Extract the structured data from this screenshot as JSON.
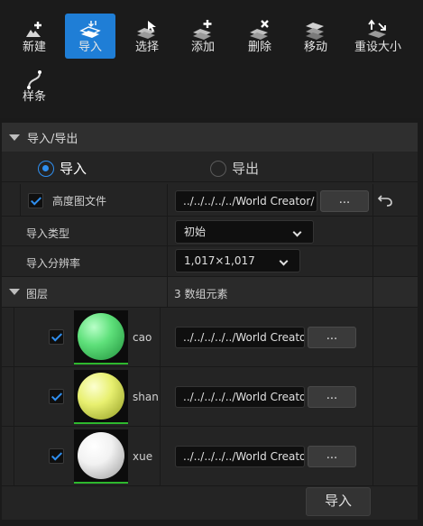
{
  "toolbar": {
    "tools": [
      {
        "label": "新建",
        "icon": "new-icon"
      },
      {
        "label": "导入",
        "icon": "import-icon",
        "active": true
      },
      {
        "label": "选择",
        "icon": "select-icon"
      },
      {
        "label": "添加",
        "icon": "add-icon"
      },
      {
        "label": "删除",
        "icon": "delete-icon"
      },
      {
        "label": "移动",
        "icon": "move-icon"
      },
      {
        "label": "重设大小",
        "icon": "resize-icon"
      },
      {
        "label": "样条",
        "icon": "spline-icon"
      }
    ]
  },
  "section": {
    "title": "导入/导出",
    "mode_import": "导入",
    "mode_export": "导出",
    "mode_selected": "import"
  },
  "heightmap": {
    "label": "高度图文件",
    "checked": true,
    "path": "../../../../../World Creator/",
    "browse": "..."
  },
  "import_type": {
    "label": "导入类型",
    "value": "初始"
  },
  "resolution": {
    "label": "导入分辨率",
    "value": "1,017×1,017"
  },
  "layers": {
    "title": "图层",
    "count": "3 数组元素",
    "items": [
      {
        "name": "cao",
        "checked": true,
        "path": "../../../../../World Creato",
        "browse": "...",
        "color": "#5ee07a"
      },
      {
        "name": "shan",
        "checked": true,
        "path": "../../../../../World Creato",
        "browse": "...",
        "color": "#e8f070"
      },
      {
        "name": "xue",
        "checked": true,
        "path": "../../../../../World Creato",
        "browse": "...",
        "color": "#f2f2f2"
      }
    ]
  },
  "footer": {
    "import_button": "导入"
  },
  "colors": {
    "accent": "#1f7ed6",
    "checkbox": "#2f8ff0",
    "thumb_border": "#2eb82e"
  }
}
